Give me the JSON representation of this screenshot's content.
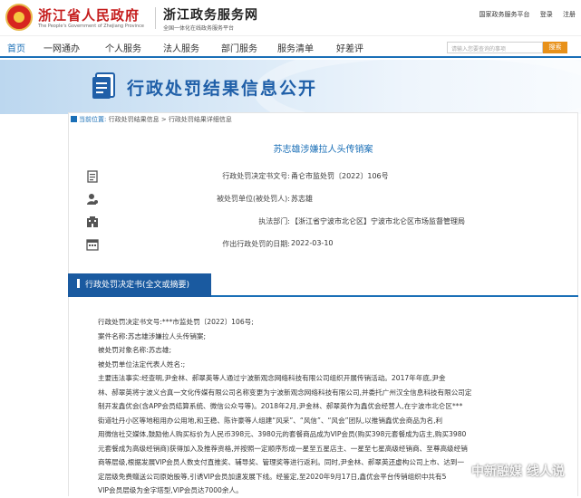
{
  "header": {
    "gov_title": "浙江省人民政府",
    "gov_subtitle": "The People's Government of Zhejiang Province",
    "service_title": "浙江政务服务网",
    "service_subtitle": "全国一体化在线政务服务平台",
    "links": [
      "国家政务服务平台",
      "登录",
      "注册"
    ]
  },
  "nav": {
    "items": [
      "首页",
      "一网通办",
      "个人服务",
      "法人服务",
      "部门服务",
      "服务清单",
      "好差评"
    ],
    "search_placeholder": "请输入您要查询的事项",
    "search_button": "搜索"
  },
  "banner": {
    "title": "行政处罚结果信息公开"
  },
  "breadcrumb": {
    "home": "当前位置:",
    "items": [
      "行政处罚结果信息",
      "行政处罚结果详细信息"
    ],
    "sep": ">"
  },
  "case_title": "苏志雄涉嫌拉人头传销案",
  "fields": [
    {
      "label": "行政处罚决定书文号:",
      "value": "甬仑市监处罚〔2022〕106号",
      "icon": "document-icon"
    },
    {
      "label": "被处罚单位(被处罚人):",
      "value": "苏志雄",
      "icon": "person-icon"
    },
    {
      "label": "执法部门:",
      "value": "【浙江省宁波市北仑区】宁波市北仑区市场监督管理局",
      "icon": "building-icon"
    },
    {
      "label": "作出行政处罚的日期:",
      "value": "2022-03-10",
      "icon": "calendar-icon"
    }
  ],
  "section_tab": "行政处罚决定书(全文或摘要)",
  "body_lines": [
    "行政处罚决定书文号:***市监处罚〔2022〕106号;",
    "案件名称:苏志雄涉嫌拉人头传销案;",
    "被处罚对象名称:苏志雄;",
    "被处罚单位法定代表人姓名:;",
    "主要违法事实:经查明,尹金林、郝翠英等人通过宁波新观念网络科技有限公司组织开展传销活动。2017年年底,尹金",
    "林、郝翠英将宁波义合真一文化传媒有限公司名称变更为宁波新观念网络科技有限公司,并委托广州汉全信息科技有限公司定",
    "制开发鑫优会(含APP会员结算系统、微信公众号等)。2018年2月,尹金林、郝翠英作为鑫优会经营人,在宁波市北仑区***",
    "街道牡丹小区等地租用办公用地,和王稳、陈许豪等人组建“风采”、“风信”、“风会”团队,以推销鑫优会商品为名,利",
    "用微信社交媒体,鼓励他人购买标价为人民币398元、3980元的套餐商品成为VIP会员(购买398元套餐成为店主,购买3980",
    "元套餐成为高级经销商)获得加入及推荐资格,并按照一定顺序形成一星至五星店主、一星至七星高级经销商、至尊高级经销",
    "商等层级,根据发展VIP会员人数支付直推奖、辅导奖、管理奖等进行返利。同时,尹金林、郝翠英还虚构公司上市、达到一",
    "定层级免费赠送公司原始股等,引诱VIP会员加速发展下线。经鉴定,至2020年9月17日,鑫优会平台传销组织中共有5",
    "VIP会员层级为金字塔型,VIP会员达7000余人。"
  ],
  "watermark": "中新融媒 线人说"
}
